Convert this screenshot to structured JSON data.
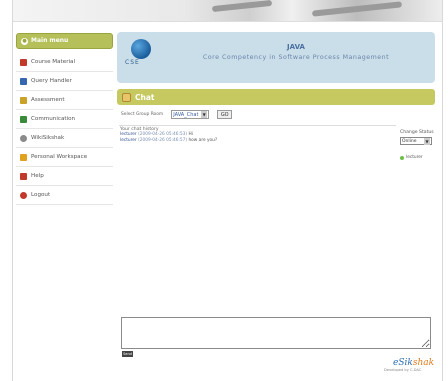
{
  "sidebar": {
    "menu_title": "Main menu",
    "items": [
      {
        "label": "Course Material",
        "icon": "book-icon",
        "color": "#c0392b"
      },
      {
        "label": "Query Handler",
        "icon": "people-icon",
        "color": "#3566b0"
      },
      {
        "label": "Assessment",
        "icon": "chart-icon",
        "color": "#c9a227"
      },
      {
        "label": "Communication",
        "icon": "network-icon",
        "color": "#3a8a3a"
      },
      {
        "label": "WikiSikshak",
        "icon": "globe-icon",
        "color": "#8a8a8a"
      },
      {
        "label": "Personal Workspace",
        "icon": "folder-icon",
        "color": "#e0a020"
      },
      {
        "label": "Help",
        "icon": "help-icon",
        "color": "#c0392b"
      },
      {
        "label": "Logout",
        "icon": "logout-icon",
        "color": "#c0392b"
      }
    ]
  },
  "header": {
    "logo_text": "CSE",
    "course_code": "JAVA",
    "course_name": "Core Competency in Software Process Management"
  },
  "chat": {
    "title": "Chat",
    "select_group_label": "Select Group Room",
    "group_value": "JAVA_Chat",
    "go_label": "GO",
    "session_label": "Your chat history",
    "messages": [
      {
        "user": "lecturer",
        "timestamp": "(2009-04-26 05:46:53)",
        "text": "Hi"
      },
      {
        "user": "lecturer",
        "timestamp": "(2009-04-26 05:46:57)",
        "text": "how are you?"
      }
    ]
  },
  "status": {
    "label": "Change Status",
    "value": "Online",
    "member": "lecturer",
    "online_color": "#6cc04a"
  },
  "composer": {
    "send_label": "Send"
  },
  "brand": {
    "name_prefix": "eSik",
    "name_suffix": "shak",
    "powered_by": "Developed by C-DAC"
  }
}
